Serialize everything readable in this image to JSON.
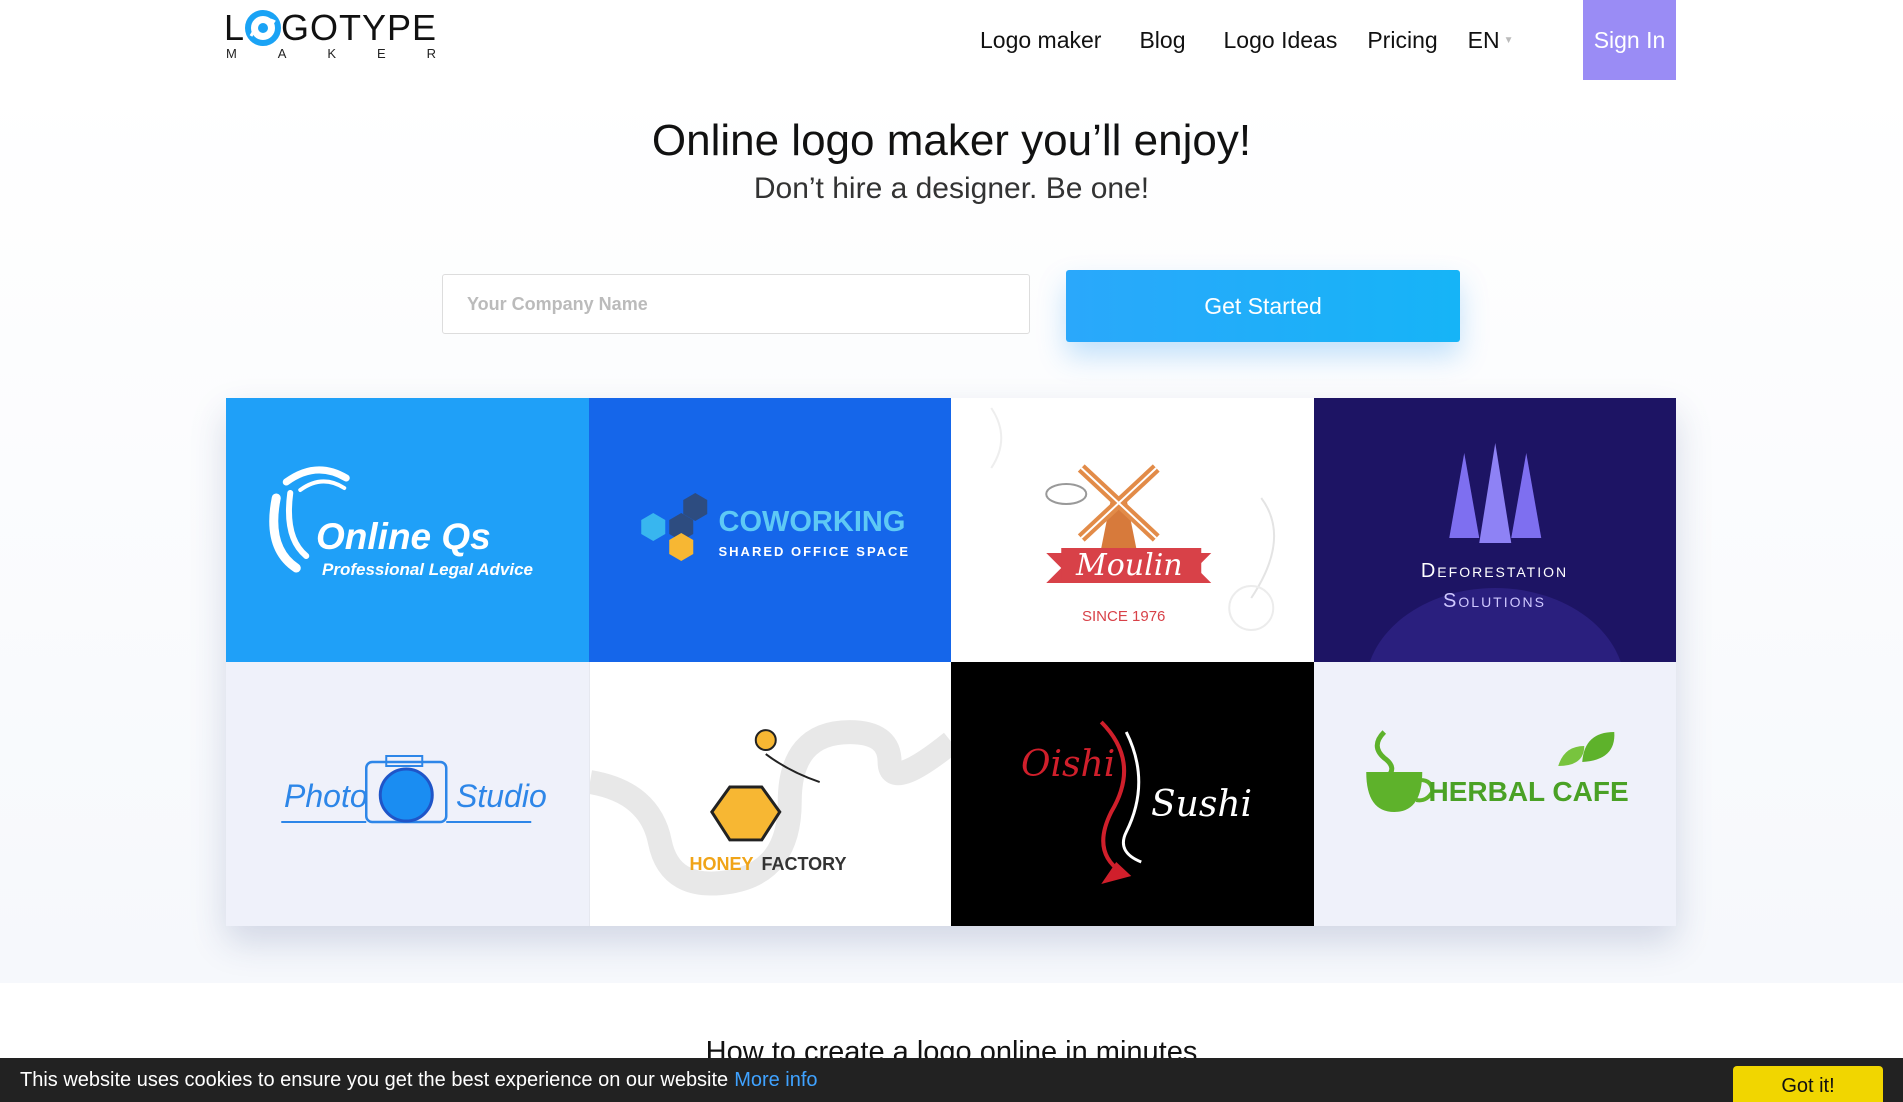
{
  "header": {
    "logo": {
      "top": "L",
      "top_rest": "GOTYPE",
      "bottom_letters": [
        "M",
        "A",
        "K",
        "E",
        "R"
      ]
    },
    "nav": [
      {
        "label": "Logo maker"
      },
      {
        "label": "Blog"
      },
      {
        "label": "Logo Ideas"
      },
      {
        "label": "Pricing"
      }
    ],
    "language": "EN",
    "signin_label": "Sign In"
  },
  "hero": {
    "headline": "Online logo maker you’ll enjoy!",
    "subline": "Don’t hire a designer. Be one!",
    "input_placeholder": "Your Company Name",
    "cta_label": "Get Started"
  },
  "tiles": [
    {
      "name": "Online Qs",
      "tagline": "Professional Legal Advice"
    },
    {
      "name": "COWORKING",
      "tagline": "SHARED OFFICE SPACE"
    },
    {
      "name": "Moulin",
      "tagline": "SINCE 1976"
    },
    {
      "name": "Deforestation",
      "tagline": "Solutions"
    },
    {
      "name": "Photo",
      "tagline": "Studio"
    },
    {
      "name": "HONEY",
      "tagline": "FACTORY"
    },
    {
      "name": "Oishi",
      "tagline": "Sushi"
    },
    {
      "name": "HERBAL CAFE",
      "tagline": ""
    }
  ],
  "colors": {
    "signin_bg": "#9a8cf5",
    "cta_bg": "#2aa8fb",
    "cookie_btn": "#f1d600",
    "cookie_link": "#3fa2ff"
  },
  "section": {
    "title": "How to create a logo online in minutes"
  },
  "cookie": {
    "text": "This website uses cookies to ensure you get the best experience on our website",
    "link_label": "More info",
    "button_label": "Got it!"
  }
}
